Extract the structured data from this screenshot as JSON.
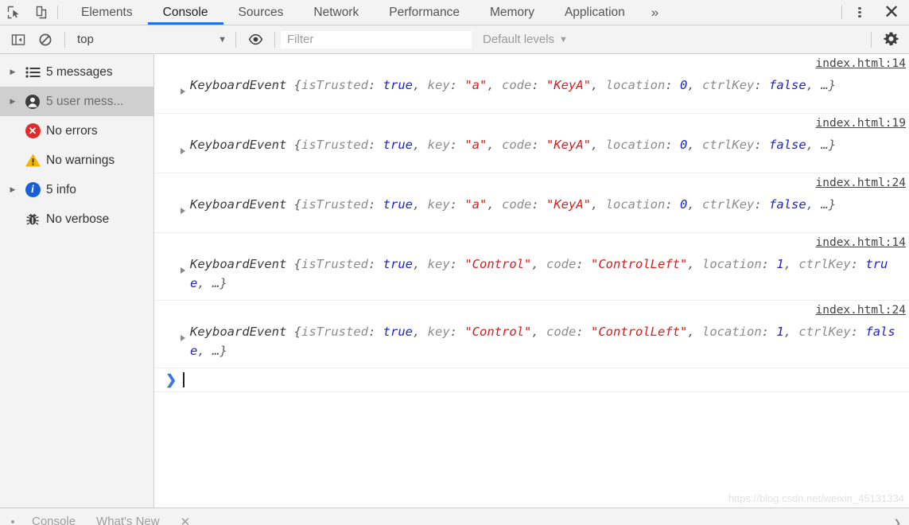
{
  "toolbar": {
    "inspect_icon": "inspect-element-icon",
    "device_icon": "device-toolbar-icon",
    "more_tabs_label": "»",
    "menu_icon": "kebab-menu-icon",
    "close_label": "✕",
    "tabs": [
      {
        "label": "Elements",
        "active": false
      },
      {
        "label": "Console",
        "active": true
      },
      {
        "label": "Sources",
        "active": false
      },
      {
        "label": "Network",
        "active": false
      },
      {
        "label": "Performance",
        "active": false
      },
      {
        "label": "Memory",
        "active": false
      },
      {
        "label": "Application",
        "active": false
      }
    ]
  },
  "filterbar": {
    "sidebar_toggle_icon": "show-console-sidebar-icon",
    "clear_icon": "clear-console-icon",
    "context": "top",
    "context_caret": "▼",
    "eye_icon": "live-expression-eye-icon",
    "filter_value": "",
    "filter_placeholder": "Filter",
    "levels_label": "Default levels",
    "levels_caret": "▼",
    "settings_icon": "settings-gear-icon"
  },
  "sidebar": {
    "items": [
      {
        "label": "5 messages",
        "icon": "message-list-icon",
        "arrow": true,
        "selected": false
      },
      {
        "label": "5 user mess...",
        "icon": "user-message-icon",
        "arrow": true,
        "selected": true
      },
      {
        "label": "No errors",
        "icon": "error-icon",
        "arrow": false,
        "selected": false
      },
      {
        "label": "No warnings",
        "icon": "warning-icon",
        "arrow": false,
        "selected": false
      },
      {
        "label": "5 info",
        "icon": "info-icon",
        "arrow": true,
        "selected": false
      },
      {
        "label": "No verbose",
        "icon": "verbose-bug-icon",
        "arrow": false,
        "selected": false
      }
    ],
    "arrow_glyph": "▶"
  },
  "console": {
    "messages": [
      {
        "source": "index.html:14",
        "class_name": "KeyboardEvent",
        "tokens": [
          {
            "t": "name",
            "v": "KeyboardEvent "
          },
          {
            "t": "punc",
            "v": "{"
          },
          {
            "t": "key",
            "v": "isTrusted"
          },
          {
            "t": "punc",
            "v": ": "
          },
          {
            "t": "bool",
            "v": "true"
          },
          {
            "t": "punc",
            "v": ", "
          },
          {
            "t": "key",
            "v": "key"
          },
          {
            "t": "punc",
            "v": ": "
          },
          {
            "t": "str",
            "v": "\"a\""
          },
          {
            "t": "punc",
            "v": ", "
          },
          {
            "t": "key",
            "v": "code"
          },
          {
            "t": "punc",
            "v": ": "
          },
          {
            "t": "str",
            "v": "\"KeyA\""
          },
          {
            "t": "punc",
            "v": ", "
          },
          {
            "t": "key",
            "v": "location"
          },
          {
            "t": "punc",
            "v": ": "
          },
          {
            "t": "num",
            "v": "0"
          },
          {
            "t": "punc",
            "v": ", "
          },
          {
            "t": "key",
            "v": "ctrlKey"
          },
          {
            "t": "punc",
            "v": ": "
          },
          {
            "t": "bool",
            "v": "false"
          },
          {
            "t": "punc",
            "v": ", …}"
          }
        ]
      },
      {
        "source": "index.html:19",
        "class_name": "KeyboardEvent",
        "tokens": [
          {
            "t": "name",
            "v": "KeyboardEvent "
          },
          {
            "t": "punc",
            "v": "{"
          },
          {
            "t": "key",
            "v": "isTrusted"
          },
          {
            "t": "punc",
            "v": ": "
          },
          {
            "t": "bool",
            "v": "true"
          },
          {
            "t": "punc",
            "v": ", "
          },
          {
            "t": "key",
            "v": "key"
          },
          {
            "t": "punc",
            "v": ": "
          },
          {
            "t": "str",
            "v": "\"a\""
          },
          {
            "t": "punc",
            "v": ", "
          },
          {
            "t": "key",
            "v": "code"
          },
          {
            "t": "punc",
            "v": ": "
          },
          {
            "t": "str",
            "v": "\"KeyA\""
          },
          {
            "t": "punc",
            "v": ", "
          },
          {
            "t": "key",
            "v": "location"
          },
          {
            "t": "punc",
            "v": ": "
          },
          {
            "t": "num",
            "v": "0"
          },
          {
            "t": "punc",
            "v": ", "
          },
          {
            "t": "key",
            "v": "ctrlKey"
          },
          {
            "t": "punc",
            "v": ": "
          },
          {
            "t": "bool",
            "v": "false"
          },
          {
            "t": "punc",
            "v": ", …}"
          }
        ]
      },
      {
        "source": "index.html:24",
        "class_name": "KeyboardEvent",
        "tokens": [
          {
            "t": "name",
            "v": "KeyboardEvent "
          },
          {
            "t": "punc",
            "v": "{"
          },
          {
            "t": "key",
            "v": "isTrusted"
          },
          {
            "t": "punc",
            "v": ": "
          },
          {
            "t": "bool",
            "v": "true"
          },
          {
            "t": "punc",
            "v": ", "
          },
          {
            "t": "key",
            "v": "key"
          },
          {
            "t": "punc",
            "v": ": "
          },
          {
            "t": "str",
            "v": "\"a\""
          },
          {
            "t": "punc",
            "v": ", "
          },
          {
            "t": "key",
            "v": "code"
          },
          {
            "t": "punc",
            "v": ": "
          },
          {
            "t": "str",
            "v": "\"KeyA\""
          },
          {
            "t": "punc",
            "v": ", "
          },
          {
            "t": "key",
            "v": "location"
          },
          {
            "t": "punc",
            "v": ": "
          },
          {
            "t": "num",
            "v": "0"
          },
          {
            "t": "punc",
            "v": ", "
          },
          {
            "t": "key",
            "v": "ctrlKey"
          },
          {
            "t": "punc",
            "v": ": "
          },
          {
            "t": "bool",
            "v": "false"
          },
          {
            "t": "punc",
            "v": ", …}"
          }
        ]
      },
      {
        "source": "index.html:14",
        "class_name": "KeyboardEvent",
        "tokens": [
          {
            "t": "name",
            "v": "KeyboardEvent "
          },
          {
            "t": "punc",
            "v": "{"
          },
          {
            "t": "key",
            "v": "isTrusted"
          },
          {
            "t": "punc",
            "v": ": "
          },
          {
            "t": "bool",
            "v": "true"
          },
          {
            "t": "punc",
            "v": ", "
          },
          {
            "t": "key",
            "v": "key"
          },
          {
            "t": "punc",
            "v": ": "
          },
          {
            "t": "str",
            "v": "\"Control\""
          },
          {
            "t": "punc",
            "v": ", "
          },
          {
            "t": "key",
            "v": "code"
          },
          {
            "t": "punc",
            "v": ": "
          },
          {
            "t": "str",
            "v": "\"ControlLeft\""
          },
          {
            "t": "punc",
            "v": ", "
          },
          {
            "t": "key",
            "v": "location"
          },
          {
            "t": "punc",
            "v": ": "
          },
          {
            "t": "num",
            "v": "1"
          },
          {
            "t": "punc",
            "v": ", "
          },
          {
            "t": "key",
            "v": "ctrlKey"
          },
          {
            "t": "punc",
            "v": ": "
          },
          {
            "t": "bool",
            "v": "true"
          },
          {
            "t": "punc",
            "v": ", …}"
          }
        ]
      },
      {
        "source": "index.html:24",
        "class_name": "KeyboardEvent",
        "tokens": [
          {
            "t": "name",
            "v": "KeyboardEvent "
          },
          {
            "t": "punc",
            "v": "{"
          },
          {
            "t": "key",
            "v": "isTrusted"
          },
          {
            "t": "punc",
            "v": ": "
          },
          {
            "t": "bool",
            "v": "true"
          },
          {
            "t": "punc",
            "v": ", "
          },
          {
            "t": "key",
            "v": "key"
          },
          {
            "t": "punc",
            "v": ": "
          },
          {
            "t": "str",
            "v": "\"Control\""
          },
          {
            "t": "punc",
            "v": ", "
          },
          {
            "t": "key",
            "v": "code"
          },
          {
            "t": "punc",
            "v": ": "
          },
          {
            "t": "str",
            "v": "\"ControlLeft\""
          },
          {
            "t": "punc",
            "v": ", "
          },
          {
            "t": "key",
            "v": "location"
          },
          {
            "t": "punc",
            "v": ": "
          },
          {
            "t": "num",
            "v": "1"
          },
          {
            "t": "punc",
            "v": ", "
          },
          {
            "t": "key",
            "v": "ctrlKey"
          },
          {
            "t": "punc",
            "v": ": "
          },
          {
            "t": "bool",
            "v": "false"
          },
          {
            "t": "punc",
            "v": ", …}"
          }
        ]
      }
    ],
    "prompt_chevron": "❯",
    "prompt_value": ""
  },
  "drawer": {
    "tabs": [
      "Console",
      "What's New"
    ],
    "close_label": "✕",
    "chevron": "❯"
  },
  "watermark": "https://blog.csdn.net/weixin_45131334",
  "colors": {
    "accent_blue": "#1a73e8",
    "error_red": "#e02b2b",
    "warning_yellow": "#f5b400",
    "info_blue": "#1a5fd4",
    "string_red": "#d51f1f",
    "bool_blue": "#1d24c8",
    "selected_row": "#cfcfcf",
    "chrome_bg": "#f3f3f3"
  }
}
